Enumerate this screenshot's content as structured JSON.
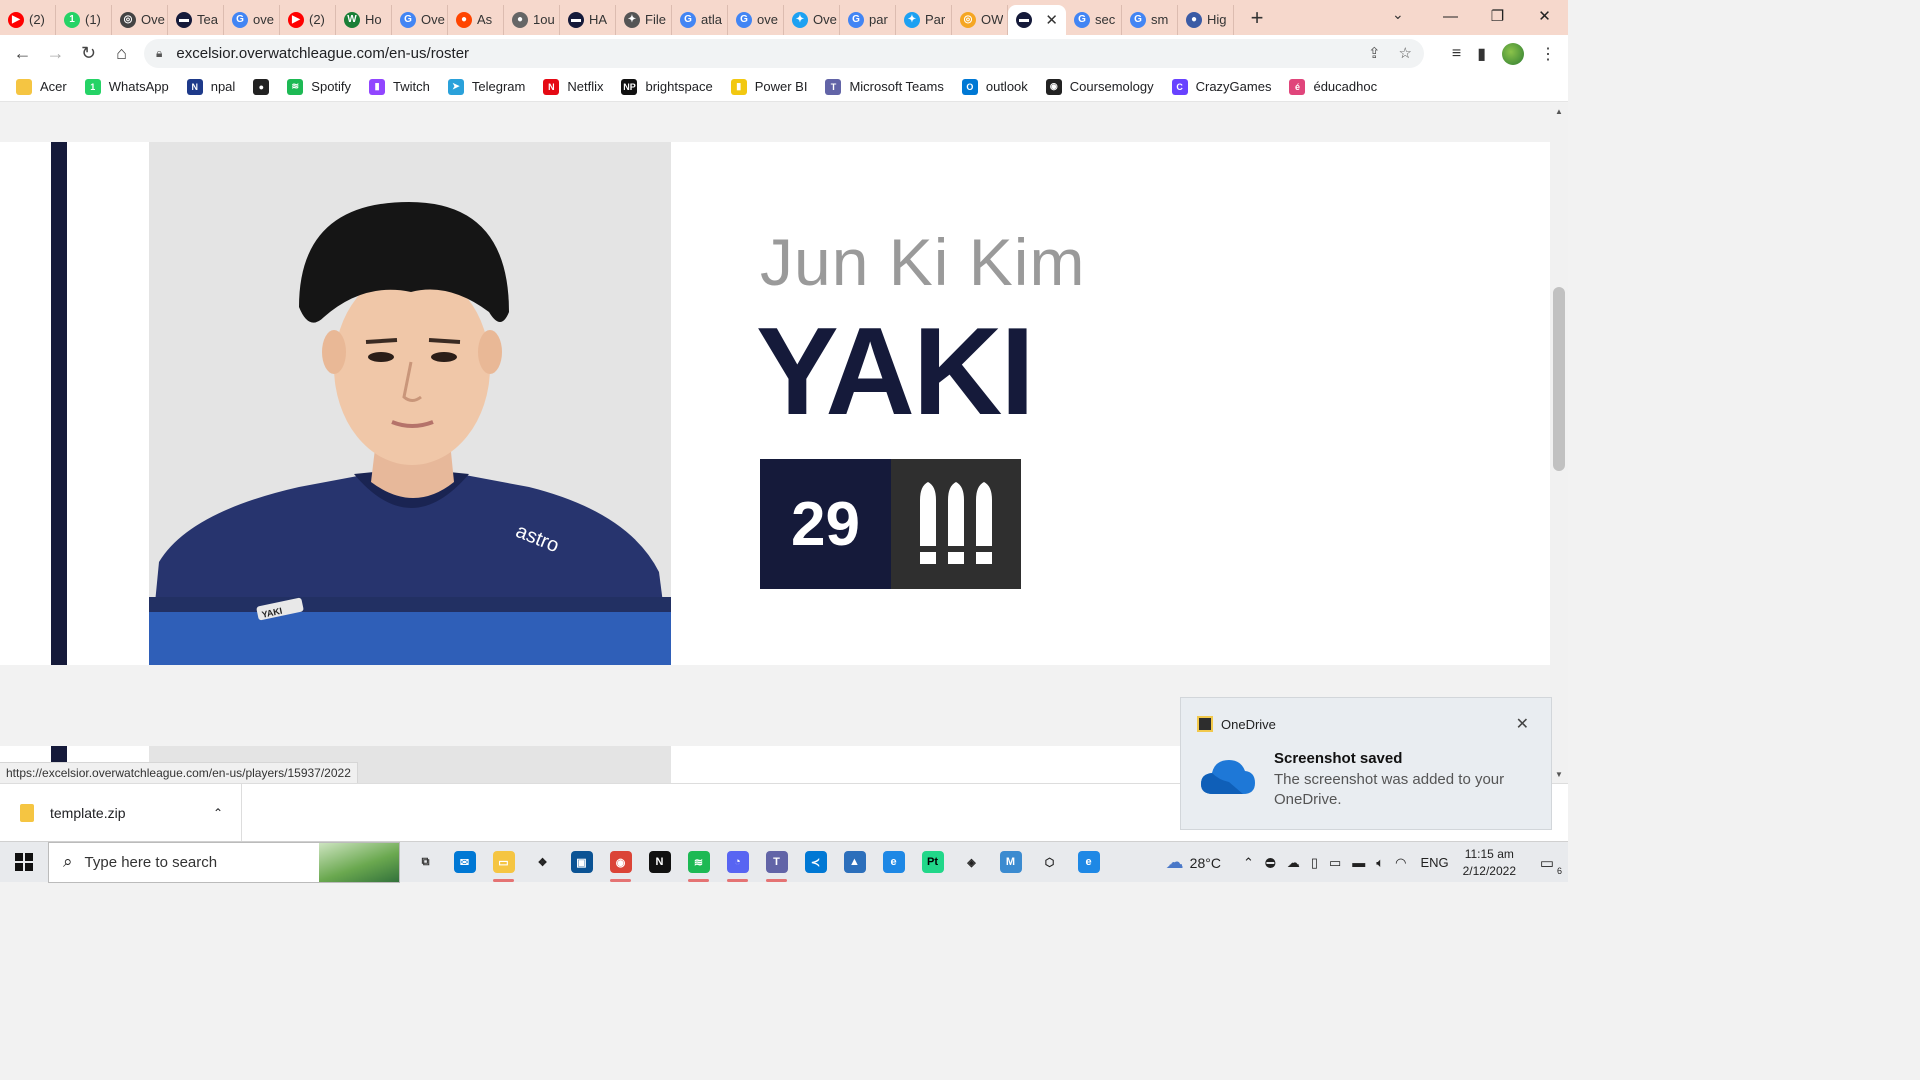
{
  "browser": {
    "tabs": [
      {
        "title": "(2)",
        "icon": "youtube-icon",
        "color": "#ff0000",
        "glyph": "▶"
      },
      {
        "title": "(1)",
        "icon": "whatsapp-icon",
        "color": "#25d366",
        "glyph": "1"
      },
      {
        "title": "Ove",
        "icon": "overwatch-icon",
        "color": "#444444",
        "glyph": "◎"
      },
      {
        "title": "Tea",
        "icon": "excelsior-icon",
        "color": "#151a3a",
        "glyph": "▬"
      },
      {
        "title": "ove",
        "icon": "google-icon",
        "color": "#4285f4",
        "glyph": "G"
      },
      {
        "title": "(2)",
        "icon": "youtube-icon",
        "color": "#ff0000",
        "glyph": "▶"
      },
      {
        "title": "Ho",
        "icon": "wiki-icon",
        "color": "#1a7f37",
        "glyph": "W"
      },
      {
        "title": "Ove",
        "icon": "google-icon",
        "color": "#4285f4",
        "glyph": "G"
      },
      {
        "title": "As",
        "icon": "reddit-icon",
        "color": "#ff4500",
        "glyph": "●"
      },
      {
        "title": "1ou",
        "icon": "globe-icon",
        "color": "#666666",
        "glyph": "●"
      },
      {
        "title": "HA",
        "icon": "excelsior-icon",
        "color": "#151a3a",
        "glyph": "▬"
      },
      {
        "title": "File",
        "icon": "file-icon",
        "color": "#555555",
        "glyph": "✦"
      },
      {
        "title": "atla",
        "icon": "google-icon",
        "color": "#4285f4",
        "glyph": "G"
      },
      {
        "title": "ove",
        "icon": "google-icon",
        "color": "#4285f4",
        "glyph": "G"
      },
      {
        "title": "Ove",
        "icon": "twitter-icon",
        "color": "#1da1f2",
        "glyph": "✦"
      },
      {
        "title": "par",
        "icon": "google-icon",
        "color": "#4285f4",
        "glyph": "G"
      },
      {
        "title": "Par",
        "icon": "twitter-icon",
        "color": "#1da1f2",
        "glyph": "✦"
      },
      {
        "title": "OW",
        "icon": "owl-icon",
        "color": "#f5a623",
        "glyph": "◎"
      },
      {
        "title": "",
        "icon": "excelsior-icon",
        "color": "#151a3a",
        "glyph": "▬",
        "active": true
      },
      {
        "title": "sec",
        "icon": "google-icon",
        "color": "#4285f4",
        "glyph": "G"
      },
      {
        "title": "sm",
        "icon": "google-icon",
        "color": "#4285f4",
        "glyph": "G"
      },
      {
        "title": "Hig",
        "icon": "globe-icon",
        "color": "#3b5ba5",
        "glyph": "●"
      }
    ],
    "url": "excelsior.overwatchleague.com/en-us/roster",
    "status_url": "https://excelsior.overwatchleague.com/en-us/players/15937/2022",
    "bookmarks": [
      {
        "label": "Acer",
        "icon": "folder-icon",
        "color": "#f5c542",
        "glyph": ""
      },
      {
        "label": "WhatsApp",
        "icon": "whatsapp-icon",
        "color": "#25d366",
        "glyph": "1"
      },
      {
        "label": "npal",
        "icon": "npal-icon",
        "color": "#1e3a8a",
        "glyph": "N"
      },
      {
        "label": "",
        "icon": "globe-icon",
        "color": "#222222",
        "glyph": "●"
      },
      {
        "label": "Spotify",
        "icon": "spotify-icon",
        "color": "#1db954",
        "glyph": "≋"
      },
      {
        "label": "Twitch",
        "icon": "twitch-icon",
        "color": "#9146ff",
        "glyph": "▮"
      },
      {
        "label": "Telegram",
        "icon": "telegram-icon",
        "color": "#2aa1da",
        "glyph": "➤"
      },
      {
        "label": "Netflix",
        "icon": "netflix-icon",
        "color": "#e50914",
        "glyph": "N"
      },
      {
        "label": "brightspace",
        "icon": "np-icon",
        "color": "#111111",
        "glyph": "NP"
      },
      {
        "label": "Power BI",
        "icon": "powerbi-icon",
        "color": "#f2c811",
        "glyph": "▮"
      },
      {
        "label": "Microsoft Teams",
        "icon": "teams-icon",
        "color": "#6264a7",
        "glyph": "T"
      },
      {
        "label": "outlook",
        "icon": "outlook-icon",
        "color": "#0078d4",
        "glyph": "O"
      },
      {
        "label": "Coursemology",
        "icon": "coursemology-icon",
        "color": "#222222",
        "glyph": "◉"
      },
      {
        "label": "CrazyGames",
        "icon": "crazygames-icon",
        "color": "#6842ff",
        "glyph": "C"
      },
      {
        "label": "éducadhoc",
        "icon": "educadhoc-icon",
        "color": "#e0457b",
        "glyph": "é"
      }
    ]
  },
  "player": {
    "real_name": "Jun Ki Kim",
    "handle": "YAKI",
    "number": "29",
    "role_icon": "damage-role-icon",
    "jersey_sponsor": "astro",
    "jersey_tag": "YAKI"
  },
  "downloads": {
    "filename": "template.zip"
  },
  "toast": {
    "app": "OneDrive",
    "title": "Screenshot saved",
    "body": "The screenshot was added to your OneDrive."
  },
  "taskbar": {
    "search_placeholder": "Type here to search",
    "temperature": "28°C",
    "language": "ENG",
    "time": "11:15 am",
    "date": "2/12/2022",
    "notification_count": "6",
    "apps": [
      {
        "name": "task-view-icon",
        "color": "#e8eaed",
        "glyph": "⧉",
        "fg": "#333333"
      },
      {
        "name": "mail-icon",
        "color": "#0078d4",
        "glyph": "✉"
      },
      {
        "name": "file-explorer-icon",
        "color": "#f5c542",
        "glyph": "▭",
        "open": true
      },
      {
        "name": "dropbox-icon",
        "color": "#e8eaed",
        "glyph": "❖",
        "fg": "#222222"
      },
      {
        "name": "app-blue-icon",
        "color": "#0b5394",
        "glyph": "▣"
      },
      {
        "name": "chrome-icon",
        "color": "#db4437",
        "glyph": "◉",
        "open": true
      },
      {
        "name": "netflix-icon",
        "color": "#111111",
        "glyph": "N"
      },
      {
        "name": "spotify-icon",
        "color": "#1db954",
        "glyph": "≋",
        "open": true
      },
      {
        "name": "discord-icon",
        "color": "#5865f2",
        "glyph": "◔",
        "open": true
      },
      {
        "name": "teams-icon",
        "color": "#6264a7",
        "glyph": "T",
        "open": true
      },
      {
        "name": "vscode-icon",
        "color": "#0078d4",
        "glyph": "≺"
      },
      {
        "name": "photos-icon",
        "color": "#2c6fbb",
        "glyph": "▲"
      },
      {
        "name": "edge-icon",
        "color": "#1e88e5",
        "glyph": "e"
      },
      {
        "name": "pycharm-icon",
        "color": "#21d789",
        "glyph": "Pt",
        "fg": "#000000"
      },
      {
        "name": "unity-icon",
        "color": "#e8eaed",
        "glyph": "◈",
        "fg": "#222222"
      },
      {
        "name": "app-m-icon",
        "color": "#3b8bd0",
        "glyph": "M"
      },
      {
        "name": "unity-hub-icon",
        "color": "#e8eaed",
        "glyph": "⬡",
        "fg": "#222222"
      },
      {
        "name": "edge-alt-icon",
        "color": "#1e88e5",
        "glyph": "e"
      }
    ]
  },
  "colors": {
    "brand_navy": "#151a3a",
    "role_box": "#2f2f2f",
    "real_name_gray": "#9a9a9a"
  }
}
